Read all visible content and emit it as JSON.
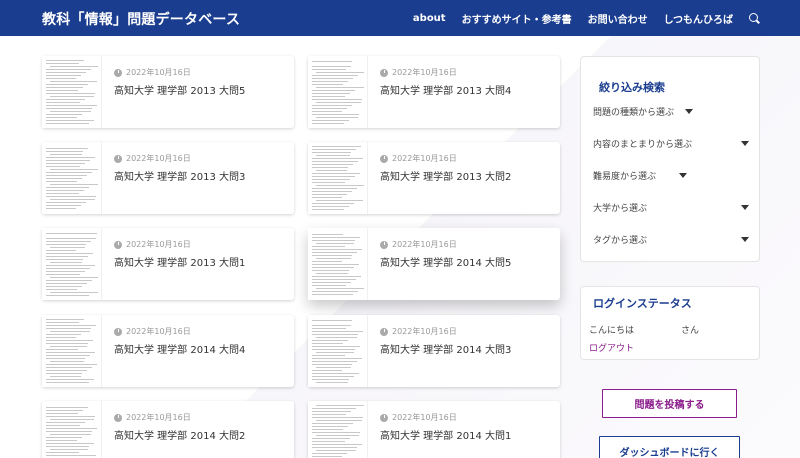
{
  "header": {
    "site_title": "教科「情報」問題データベース",
    "nav": [
      "about",
      "おすすめサイト・参考書",
      "お問い合わせ",
      "しつもんひろば"
    ]
  },
  "cards": [
    {
      "date": "2022年10月16日",
      "title": "高知大学 理学部 2013 大問5"
    },
    {
      "date": "2022年10月16日",
      "title": "高知大学 理学部 2013 大問4"
    },
    {
      "date": "2022年10月16日",
      "title": "高知大学 理学部 2013 大問3"
    },
    {
      "date": "2022年10月16日",
      "title": "高知大学 理学部 2013 大問2"
    },
    {
      "date": "2022年10月16日",
      "title": "高知大学 理学部 2013 大問1"
    },
    {
      "date": "2022年10月16日",
      "title": "高知大学 理学部 2014 大問5"
    },
    {
      "date": "2022年10月16日",
      "title": "高知大学 理学部 2014 大問4"
    },
    {
      "date": "2022年10月16日",
      "title": "高知大学 理学部 2014 大問3"
    },
    {
      "date": "2022年10月16日",
      "title": "高知大学 理学部 2014 大問2"
    },
    {
      "date": "2022年10月16日",
      "title": "高知大学 理学部 2014 大問1"
    }
  ],
  "sidebar": {
    "filter_title": "絞り込み検索",
    "filters": [
      "問題の種類から選ぶ",
      "内容のまとまりから選ぶ",
      "難易度から選ぶ",
      "大学から選ぶ",
      "タグから選ぶ"
    ],
    "login_title": "ログインステータス",
    "greeting": "こんにちは",
    "san": "さん",
    "logout": "ログアウト",
    "post_button": "問題を投稿する",
    "dashboard_button": "ダッシュボードに行く"
  },
  "colors": {
    "header_bg": "#1a3d8f",
    "accent_purple": "#8b1c8b"
  }
}
